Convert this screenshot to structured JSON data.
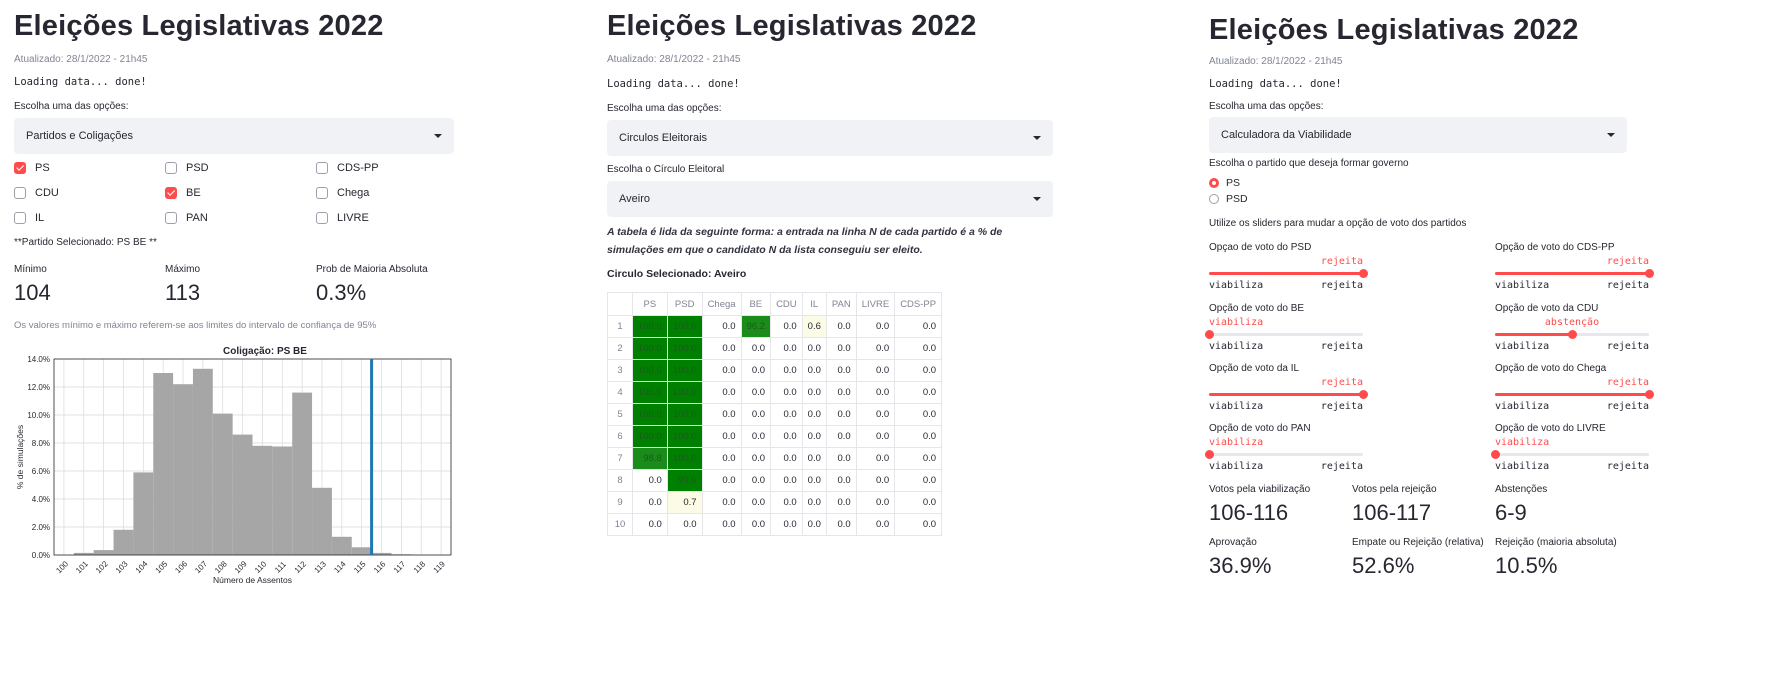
{
  "colors": {
    "accent": "#ff4b4b",
    "bar": "#a6a6a6",
    "vline": "#1f77b4"
  },
  "p1": {
    "title": "Eleições Legislativas 2022",
    "updated": "Atualizado: 28/1/2022 - 21h45",
    "loading": "Loading data... done!",
    "select_label": "Escolha uma das opções:",
    "select_value": "Partidos e Coligações",
    "checkboxes": [
      {
        "label": "PS",
        "checked": true
      },
      {
        "label": "PSD",
        "checked": false
      },
      {
        "label": "CDS-PP",
        "checked": false
      },
      {
        "label": "CDU",
        "checked": false
      },
      {
        "label": "BE",
        "checked": true
      },
      {
        "label": "Chega",
        "checked": false
      },
      {
        "label": "IL",
        "checked": false
      },
      {
        "label": "PAN",
        "checked": false
      },
      {
        "label": "LIVRE",
        "checked": false
      }
    ],
    "selected_text": "**Partido Selecionado: PS BE **",
    "metrics": [
      {
        "label": "Mínimo",
        "value": "104"
      },
      {
        "label": "Máximo",
        "value": "113"
      },
      {
        "label": "Prob de Maioria Absoluta",
        "value": "0.3%"
      }
    ],
    "note": "Os valores mínimo e máximo referem-se aos limites do intervalo de confiança de 95%"
  },
  "chart_data": {
    "type": "bar",
    "title": "Coligação:  PS  BE",
    "xlabel": "Número de Assentos",
    "ylabel": "% de simulações",
    "categories": [
      "100",
      "101",
      "102",
      "103",
      "104",
      "105",
      "106",
      "107",
      "108",
      "109",
      "110",
      "111",
      "112",
      "113",
      "114",
      "115",
      "116",
      "117",
      "118",
      "119"
    ],
    "values": [
      0.0,
      0.15,
      0.35,
      1.8,
      5.9,
      13.0,
      12.2,
      13.3,
      10.1,
      8.6,
      7.8,
      7.75,
      11.6,
      4.8,
      1.3,
      0.55,
      0.15,
      0.05,
      0.0,
      0.0
    ],
    "ylim": [
      0,
      14
    ],
    "yticks": [
      "0.0%",
      "2.0%",
      "4.0%",
      "6.0%",
      "8.0%",
      "10.0%",
      "12.0%",
      "14.0%"
    ],
    "vline_x": 116,
    "grid": true
  },
  "p2": {
    "title": "Eleições Legislativas 2022",
    "updated": "Atualizado: 28/1/2022 - 21h45",
    "loading": "Loading data... done!",
    "select_label": "Escolha uma das opções:",
    "select_value": "Circulos Eleitorais",
    "circle_label": "Escolha o Círculo Eleitoral",
    "circle_value": "Aveiro",
    "italic": "A tabela é lida da seguinte forma: a entrada na linha N de cada partido é a % de simulações em que o candidato N da lista conseguiu ser eleito.",
    "selected": "Circulo Selecionado: Aveiro",
    "table": {
      "headers": [
        "PS",
        "PSD",
        "Chega",
        "BE",
        "CDU",
        "IL",
        "PAN",
        "LIVRE",
        "CDS-PP"
      ],
      "rows": [
        {
          "idx": "1",
          "cells": [
            "100.0",
            "100.0",
            "0.0",
            "96.2",
            "0.0",
            "0.6",
            "0.0",
            "0.0",
            "0.0"
          ]
        },
        {
          "idx": "2",
          "cells": [
            "100.0",
            "100.0",
            "0.0",
            "0.0",
            "0.0",
            "0.0",
            "0.0",
            "0.0",
            "0.0"
          ]
        },
        {
          "idx": "3",
          "cells": [
            "100.0",
            "100.0",
            "0.0",
            "0.0",
            "0.0",
            "0.0",
            "0.0",
            "0.0",
            "0.0"
          ]
        },
        {
          "idx": "4",
          "cells": [
            "100.0",
            "100.0",
            "0.0",
            "0.0",
            "0.0",
            "0.0",
            "0.0",
            "0.0",
            "0.0"
          ]
        },
        {
          "idx": "5",
          "cells": [
            "100.0",
            "100.0",
            "0.0",
            "0.0",
            "0.0",
            "0.0",
            "0.0",
            "0.0",
            "0.0"
          ]
        },
        {
          "idx": "6",
          "cells": [
            "100.0",
            "100.0",
            "0.0",
            "0.0",
            "0.0",
            "0.0",
            "0.0",
            "0.0",
            "0.0"
          ]
        },
        {
          "idx": "7",
          "cells": [
            "98.8",
            "100.0",
            "0.0",
            "0.0",
            "0.0",
            "0.0",
            "0.0",
            "0.0",
            "0.0"
          ]
        },
        {
          "idx": "8",
          "cells": [
            "0.0",
            "99.9",
            "0.0",
            "0.0",
            "0.0",
            "0.0",
            "0.0",
            "0.0",
            "0.0"
          ]
        },
        {
          "idx": "9",
          "cells": [
            "0.0",
            "0.7",
            "0.0",
            "0.0",
            "0.0",
            "0.0",
            "0.0",
            "0.0",
            "0.0"
          ]
        },
        {
          "idx": "10",
          "cells": [
            "0.0",
            "0.0",
            "0.0",
            "0.0",
            "0.0",
            "0.0",
            "0.0",
            "0.0",
            "0.0"
          ]
        }
      ]
    }
  },
  "p3": {
    "title": "Eleições Legislativas 2022",
    "updated": "Atualizado: 28/1/2022 - 21h45",
    "loading": "Loading data... done!",
    "select_label": "Escolha uma das opções:",
    "select_value": "Calculadora da Viabilidade",
    "radio_label": "Escolha o partido que deseja formar governo",
    "radios": [
      {
        "label": "PS",
        "checked": true
      },
      {
        "label": "PSD",
        "checked": false
      }
    ],
    "slider_intro": "Utilize os sliders para mudar a opção de voto dos partidos",
    "slider_min": "viabiliza",
    "slider_max": "rejeita",
    "sliders": [
      {
        "label": "Opçao de voto do PSD",
        "value": "rejeita",
        "level": 1.0
      },
      {
        "label": "Opção de voto do CDS-PP",
        "value": "rejeita",
        "level": 1.0
      },
      {
        "label": "Opção de voto do BE",
        "value": "viabiliza",
        "level": 0.0
      },
      {
        "label": "Opção de voto da CDU",
        "value": "abstenção",
        "level": 0.5
      },
      {
        "label": "Opção de voto da IL",
        "value": "rejeita",
        "level": 1.0
      },
      {
        "label": "Opção de voto do Chega",
        "value": "rejeita",
        "level": 1.0
      },
      {
        "label": "Opção de voto do PAN",
        "value": "viabiliza",
        "level": 0.0
      },
      {
        "label": "Opção de voto do LIVRE",
        "value": "viabiliza",
        "level": 0.0
      }
    ],
    "metrics": [
      {
        "label": "Votos pela viabilização",
        "value": "106-116"
      },
      {
        "label": "Votos pela rejeição",
        "value": "106-117"
      },
      {
        "label": "Abstenções",
        "value": "6-9"
      },
      {
        "label": "Aprovação",
        "value": "36.9%"
      },
      {
        "label": "Empate ou Rejeição (relativa)",
        "value": "52.6%"
      },
      {
        "label": "Rejeição (maioria absoluta)",
        "value": "10.5%"
      }
    ]
  }
}
